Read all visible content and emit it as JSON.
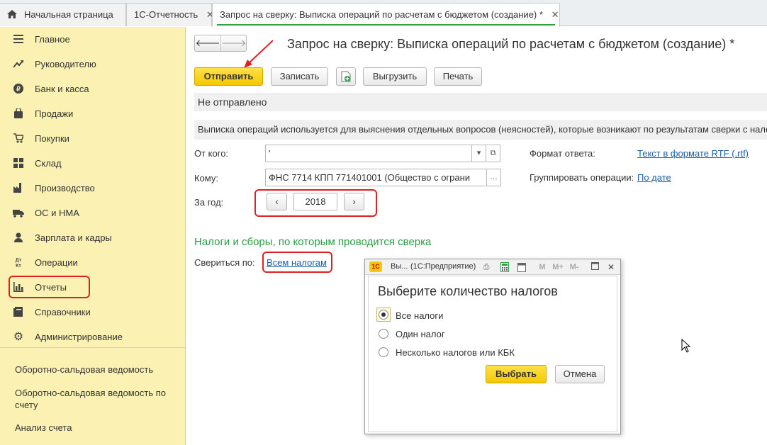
{
  "tabs": [
    {
      "label": "Начальная страница"
    },
    {
      "label": "1С-Отчетность"
    },
    {
      "label": "Запрос на сверку: Выписка операций по расчетам с бюджетом (создание) *"
    }
  ],
  "sidebar": {
    "items": [
      {
        "label": "Главное",
        "icon": "menu-icon"
      },
      {
        "label": "Руководителю",
        "icon": "trend-icon"
      },
      {
        "label": "Банк и касса",
        "icon": "ruble-coin-icon"
      },
      {
        "label": "Продажи",
        "icon": "shopping-bag-icon"
      },
      {
        "label": "Покупки",
        "icon": "cart-icon"
      },
      {
        "label": "Склад",
        "icon": "warehouse-icon"
      },
      {
        "label": "Производство",
        "icon": "factory-icon"
      },
      {
        "label": "ОС и НМА",
        "icon": "truck-icon"
      },
      {
        "label": "Зарплата и кадры",
        "icon": "person-icon"
      },
      {
        "label": "Операции",
        "icon": "debit-credit-icon",
        "icon_text": "Дт Кт"
      },
      {
        "label": "Отчеты",
        "icon": "bar-chart-icon"
      },
      {
        "label": "Справочники",
        "icon": "book-icon"
      },
      {
        "label": "Администрирование",
        "icon": "gear-icon"
      }
    ],
    "sub_items": [
      {
        "label": "Оборотно-сальдовая ведомость"
      },
      {
        "label": "Оборотно-сальдовая ведомость по счету"
      },
      {
        "label": "Анализ счета"
      }
    ]
  },
  "toolbar": {
    "send": "Отправить",
    "save": "Записать",
    "export": "Выгрузить",
    "print": "Печать"
  },
  "title": "Запрос на сверку: Выписка операций по расчетам с бюджетом (создание) *",
  "status": "Не отправлено",
  "info": "Выписка операций используется для выяснения отдельных вопросов (неясностей), которые возникают по результатам сверки с нало",
  "form": {
    "from_label": "От кого:",
    "from_value": "'",
    "to_label": "Кому:",
    "to_value": "ФНС 7714 КПП 771401001 (Общество с ограни",
    "year_label": "За год:",
    "year_value": "2018",
    "format_label": "Формат ответа:",
    "format_value": "Текст в формате RTF (.rtf)",
    "group_label": "Группировать операции:",
    "group_value": "По дате"
  },
  "taxes": {
    "section_title": "Налоги и сборы, по которым проводится сверка",
    "reconcile_label": "Свериться по:",
    "reconcile_value": "Всем налогам"
  },
  "dialog": {
    "app_badge": "1С",
    "title_short": "Вы...",
    "title_app": "(1С:Предприятие)",
    "heading": "Выберите количество налогов",
    "options": [
      {
        "label": "Все налоги",
        "selected": true
      },
      {
        "label": "Один налог",
        "selected": false
      },
      {
        "label": "Несколько налогов или КБК",
        "selected": false
      }
    ],
    "ok": "Выбрать",
    "cancel": "Отмена",
    "toolbar_m": "M",
    "toolbar_mplus": "M+",
    "toolbar_mminus": "M-"
  },
  "colors": {
    "sidebar_bg": "#fbf1b2",
    "accent_yellow": "#f5c800",
    "highlight_red": "#e02020",
    "link_blue": "#1b5fa8",
    "section_green": "#2a9d43"
  }
}
